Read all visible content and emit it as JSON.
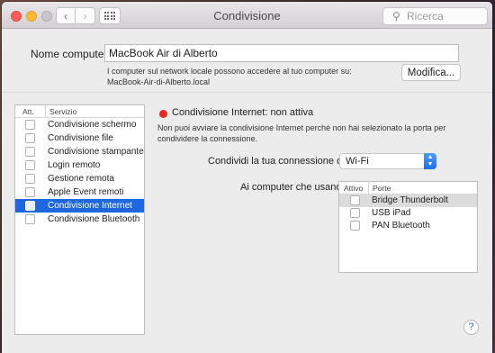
{
  "window": {
    "title": "Condivisione",
    "search_placeholder": "Ricerca",
    "nav_back": "‹",
    "nav_forward": "›"
  },
  "computer_name": {
    "label": "Nome computer:",
    "value": "MacBook Air di Alberto",
    "info_line1": "I computer sul network locale possono accedere al tuo computer su:",
    "info_line2": "MacBook-Air-di-Alberto.local",
    "edit_button": "Modifica..."
  },
  "services": {
    "col_active": "Att.",
    "col_service": "Servizio",
    "items": [
      {
        "label": "Condivisione schermo",
        "checked": false
      },
      {
        "label": "Condivisione file",
        "checked": false
      },
      {
        "label": "Condivisione stampante",
        "checked": false
      },
      {
        "label": "Login remoto",
        "checked": false
      },
      {
        "label": "Gestione remota",
        "checked": false
      },
      {
        "label": "Apple Event remoti",
        "checked": false
      },
      {
        "label": "Condivisione Internet",
        "checked": false
      },
      {
        "label": "Condivisione Bluetooth",
        "checked": false
      }
    ],
    "selected_index": 6
  },
  "detail": {
    "status_title": "Condivisione Internet: non attiva",
    "status_color": "#e62a1f",
    "status_desc": "Non puoi avviare la condivisione Internet perché non hai selezionato la porta per condividere la connessione.",
    "share_label": "Condividi la tua connessione da:",
    "share_value": "Wi-Fi",
    "computers_label": "Ai computer che usano:",
    "ports_col_active": "Attivo",
    "ports_col_port": "Porte",
    "ports": [
      {
        "label": "Bridge Thunderbolt",
        "checked": false
      },
      {
        "label": "USB iPad",
        "checked": false
      },
      {
        "label": "PAN Bluetooth",
        "checked": false
      }
    ]
  },
  "help_label": "?",
  "colors": {
    "accent": "#1f67e0",
    "window_bg": "#ececec"
  }
}
